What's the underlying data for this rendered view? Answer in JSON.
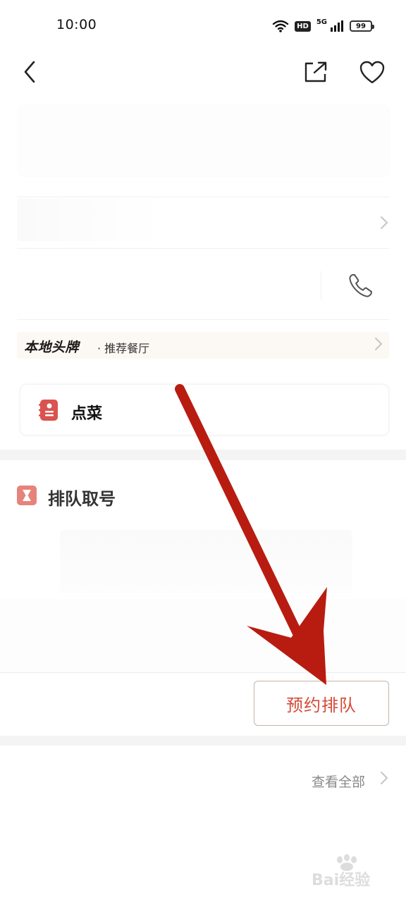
{
  "status_bar": {
    "time": "10:00",
    "network_label": "5G",
    "hd_label": "HD",
    "battery": "99",
    "icons": [
      "wifi-icon",
      "hd-icon",
      "signal-icon",
      "battery-icon"
    ]
  },
  "nav": {
    "icons": [
      "back-arrow-icon",
      "share-icon",
      "heart-icon"
    ]
  },
  "brand_banner": {
    "logo": "本地头牌",
    "subtitle": "· 推荐餐厅"
  },
  "order": {
    "label": "点菜",
    "icon": "menu-book-icon"
  },
  "queue": {
    "title": "排队取号",
    "icon": "hourglass-icon",
    "reserve_button": "预约排队"
  },
  "footer": {
    "view_all": "查看全部"
  },
  "watermark": {
    "text": "Bai经验"
  },
  "colors": {
    "accent_red": "#d54a36",
    "arrow_red": "#b81c11",
    "brand_banner_bg": "#fcf8f3"
  }
}
